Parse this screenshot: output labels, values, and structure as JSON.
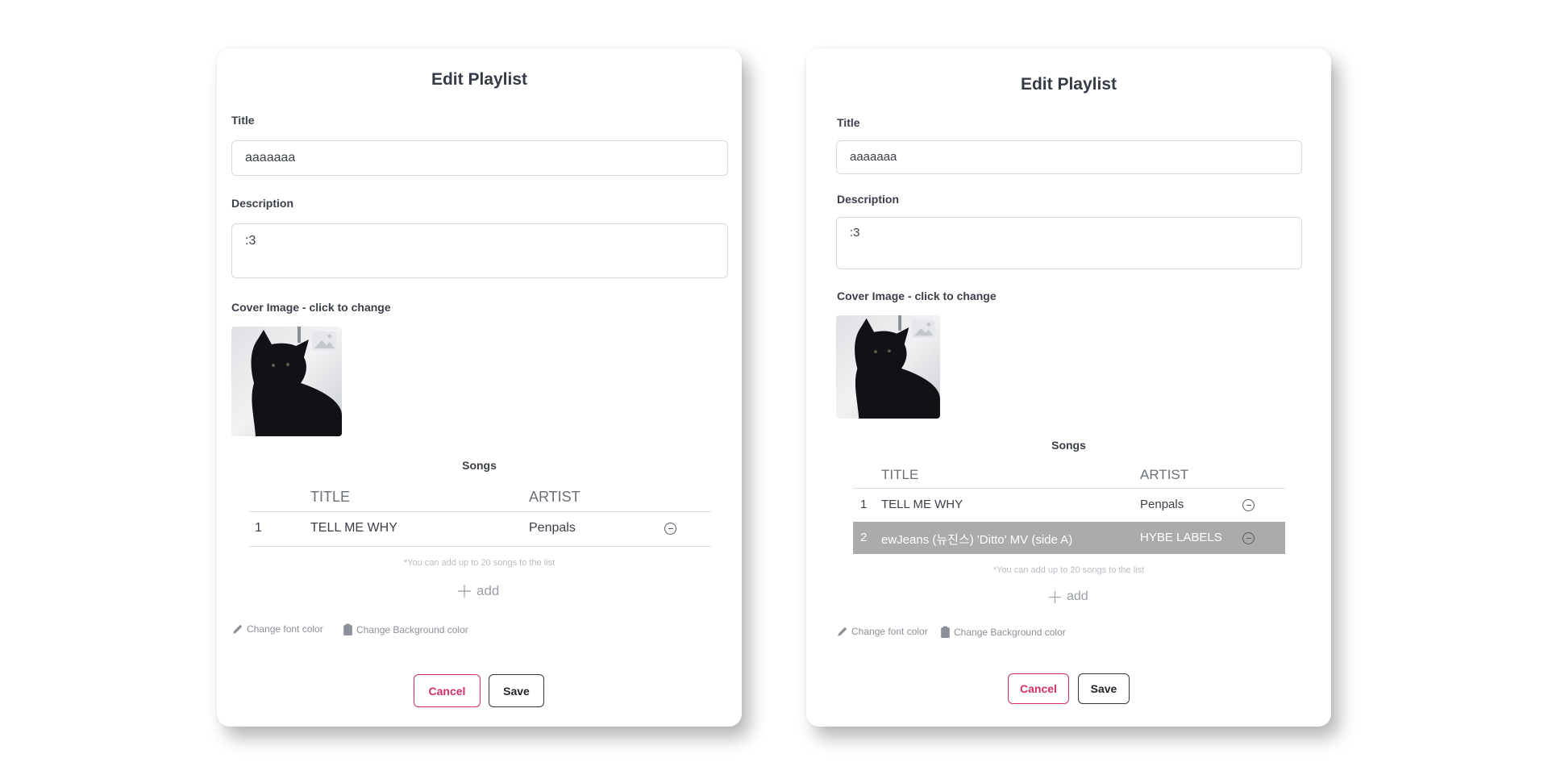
{
  "colors": {
    "accent_cancel": "#cf2e6b",
    "selected_row": "#ababab",
    "text": "#3b3f4a"
  },
  "left": {
    "heading": "Edit Playlist",
    "title_label": "Title",
    "title_value": "aaaaaaa",
    "description_label": "Description",
    "description_value": ":3",
    "cover_label": "Cover Image - click to change",
    "cover_icon": "image-placeholder-icon",
    "songs_label": "Songs",
    "columns": [
      "TITLE",
      "ARTIST"
    ],
    "songs": [
      {
        "index": "1",
        "title": "TELL ME WHY",
        "artist": "Penpals"
      }
    ],
    "note": "*You can add up to 20 songs to the list",
    "add_label": "add",
    "font_color_label": "Change font color",
    "bg_color_label": "Change Background color",
    "cancel_label": "Cancel",
    "save_label": "Save"
  },
  "right": {
    "heading": "Edit Playlist",
    "title_label": "Title",
    "title_value": "aaaaaaa",
    "description_label": "Description",
    "description_value": ":3",
    "cover_label": "Cover Image - click to change",
    "cover_icon": "image-placeholder-icon",
    "songs_label": "Songs",
    "columns": [
      "TITLE",
      "ARTIST"
    ],
    "songs": [
      {
        "index": "1",
        "title": "TELL ME WHY",
        "artist": "Penpals"
      },
      {
        "index": "2",
        "title": "ewJeans (뉴진스) 'Ditto' MV (side A)",
        "artist": "HYBE LABELS",
        "selected": true
      }
    ],
    "note": "*You can add up to 20 songs to the list",
    "add_label": "add",
    "font_color_label": "Change font color",
    "bg_color_label": "Change Background color",
    "cancel_label": "Cancel",
    "save_label": "Save"
  }
}
